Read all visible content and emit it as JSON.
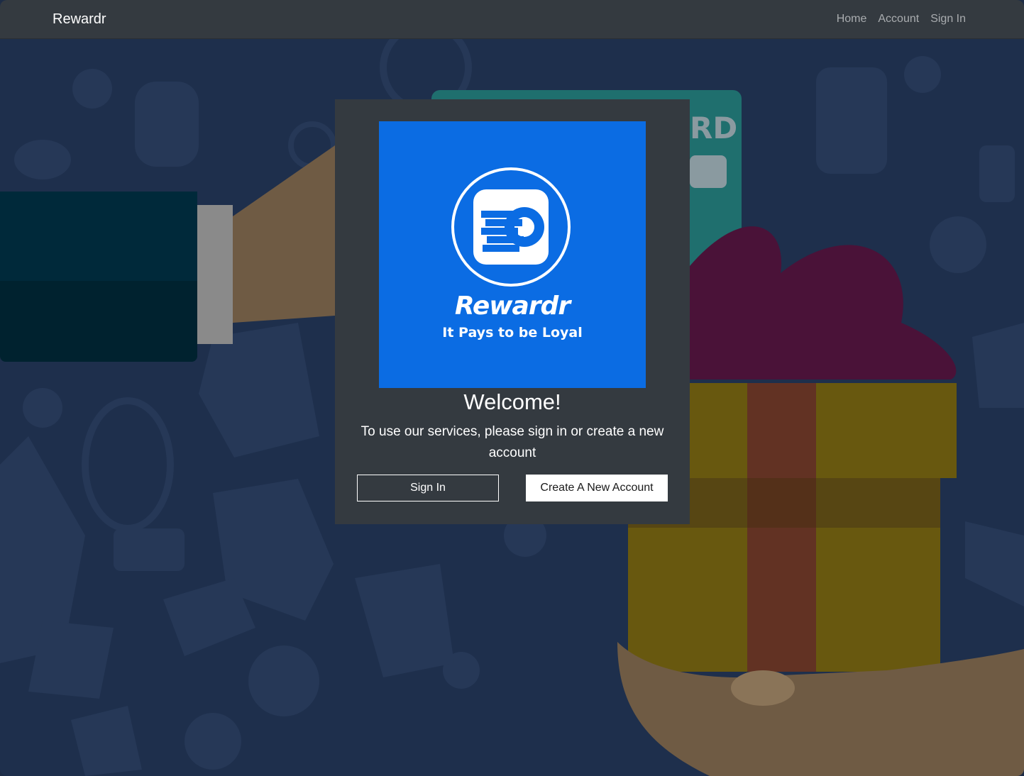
{
  "navbar": {
    "brand": "Rewardr",
    "links": [
      "Home",
      "Account",
      "Sign In"
    ]
  },
  "background": {
    "card_text": "RD"
  },
  "card": {
    "logo": {
      "title": "Rewardr",
      "tagline": "It Pays to be Loyal",
      "background_color": "#0b6ce3"
    },
    "welcome": "Welcome!",
    "description": "To use our services, please sign in or create a new account",
    "sign_in_label": "Sign In",
    "create_account_label": "Create A New Account"
  },
  "colors": {
    "navbar": "#343a40",
    "card": "#343a40",
    "background": "#1e2f4c",
    "brand_blue": "#0b6ce3"
  }
}
